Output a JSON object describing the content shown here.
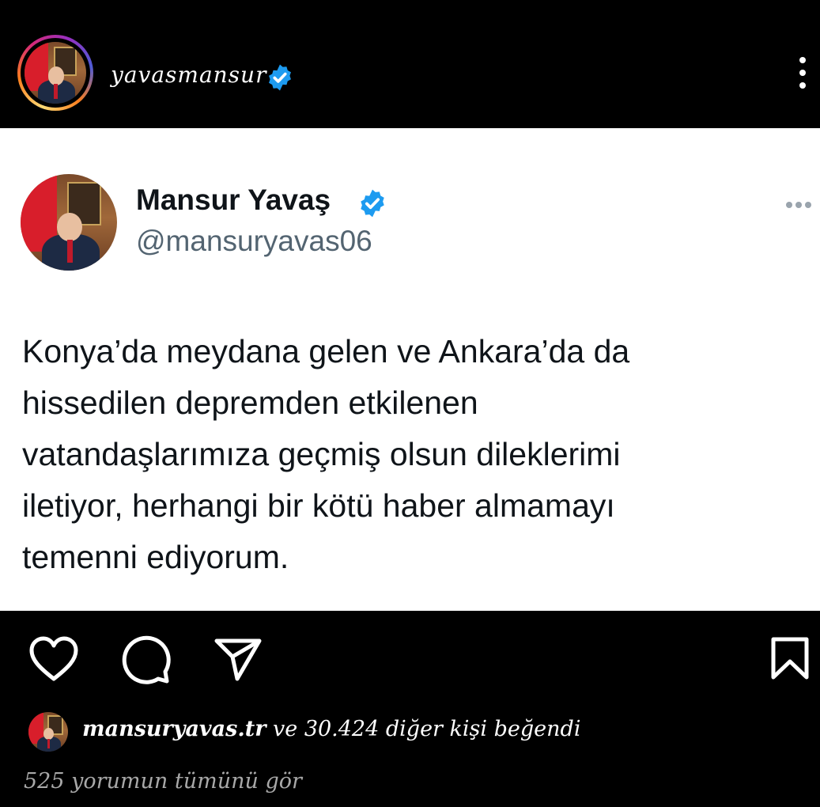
{
  "header": {
    "username": "yavasmansur",
    "verified": true,
    "menu_icon": "more-vertical-icon"
  },
  "tweet": {
    "display_name": "Mansur Yavaş",
    "handle": "@mansuryavas06",
    "verified": true,
    "menu_icon": "more-horizontal-icon",
    "body_lines": [
      "Konya’da meydana gelen ve Ankara’da da",
      "hissedilen depremden etkilenen",
      "vatandaşlarımıza geçmiş olsun dileklerimi",
      "iletiyor, herhangi bir kötü haber almamayı",
      "temenni ediyorum."
    ]
  },
  "actions": {
    "like_icon": "heart-icon",
    "comment_icon": "comment-icon",
    "share_icon": "send-icon",
    "save_icon": "bookmark-icon"
  },
  "likes": {
    "liker": "mansuryavas.tr",
    "rest": " ve 30.424 diğer kişi beğendi"
  },
  "comments": {
    "link_text": "525 yorumun tümünü gör"
  },
  "colors": {
    "background": "#000000",
    "card": "#ffffff",
    "verified": "#1d9bf0",
    "handle": "#536471",
    "muted": "#a8a8a8"
  }
}
